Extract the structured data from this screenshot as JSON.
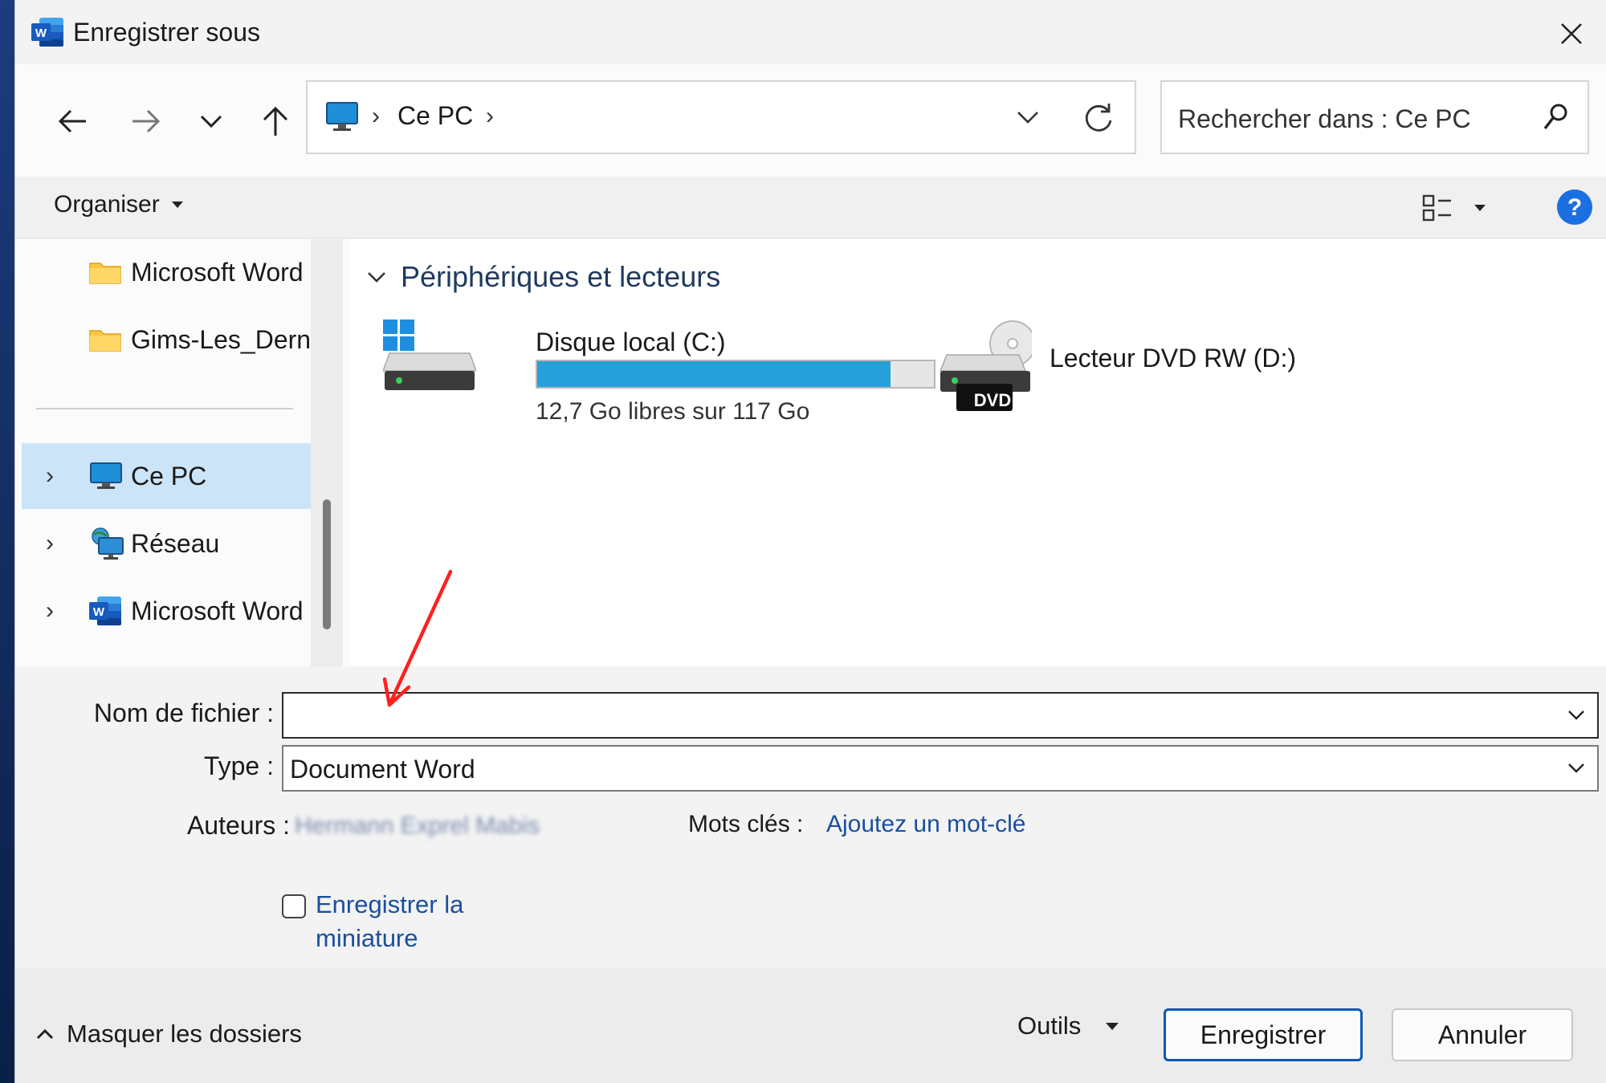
{
  "window": {
    "title": "Enregistrer sous",
    "app_icon": "word-icon",
    "close_icon": "close-icon"
  },
  "nav": {
    "back_icon": "arrow-left-icon",
    "forward_icon": "arrow-right-icon",
    "recent_icon": "chevron-down-icon",
    "up_icon": "arrow-up-icon"
  },
  "address": {
    "location_icon": "computer-icon",
    "crumbs": [
      "Ce PC"
    ],
    "refresh_icon": "refresh-icon"
  },
  "search": {
    "placeholder": "Rechercher dans : Ce PC",
    "icon": "search-icon"
  },
  "toolbar": {
    "organize_label": "Organiser",
    "view_icon": "view-details-icon",
    "help_icon": "help-icon"
  },
  "sidebar": {
    "items": [
      {
        "label": "Microsoft Word",
        "icon": "folder-icon",
        "expandable": false
      },
      {
        "label": "Gims-Les_Derniers",
        "icon": "folder-icon",
        "expandable": false
      },
      {
        "label": "Ce PC",
        "icon": "computer-icon",
        "expandable": true,
        "selected": true
      },
      {
        "label": "Réseau",
        "icon": "network-icon",
        "expandable": true
      },
      {
        "label": "Microsoft Word",
        "icon": "word-icon",
        "expandable": true
      }
    ]
  },
  "content": {
    "group_label": "Périphériques et lecteurs",
    "drives": [
      {
        "name": "Disque local (C:)",
        "free_text": "12,7 Go libres sur 117 Go",
        "used_fraction": 0.891,
        "icon": "windows-drive-icon"
      },
      {
        "name": "Lecteur DVD RW (D:)",
        "icon": "dvd-drive-icon",
        "badge": "DVD"
      }
    ]
  },
  "form": {
    "filename_label": "Nom de fichier :",
    "filename_value": "",
    "type_label": "Type :",
    "type_value": "Document Word",
    "authors_label": "Auteurs :",
    "authors_value": "Hermann Exprel Mabis",
    "keywords_label": "Mots clés :",
    "keywords_value": "Ajoutez un mot-clé",
    "thumbnail_label": "Enregistrer la miniature",
    "thumbnail_checked": false
  },
  "footer": {
    "hide_folders_label": "Masquer les dossiers",
    "tools_label": "Outils",
    "save_label": "Enregistrer",
    "cancel_label": "Annuler"
  },
  "colors": {
    "accent": "#0a58b6",
    "selection": "#cce4f7",
    "drive_bar": "#26a0da",
    "annotation_arrow": "#ff2020"
  }
}
